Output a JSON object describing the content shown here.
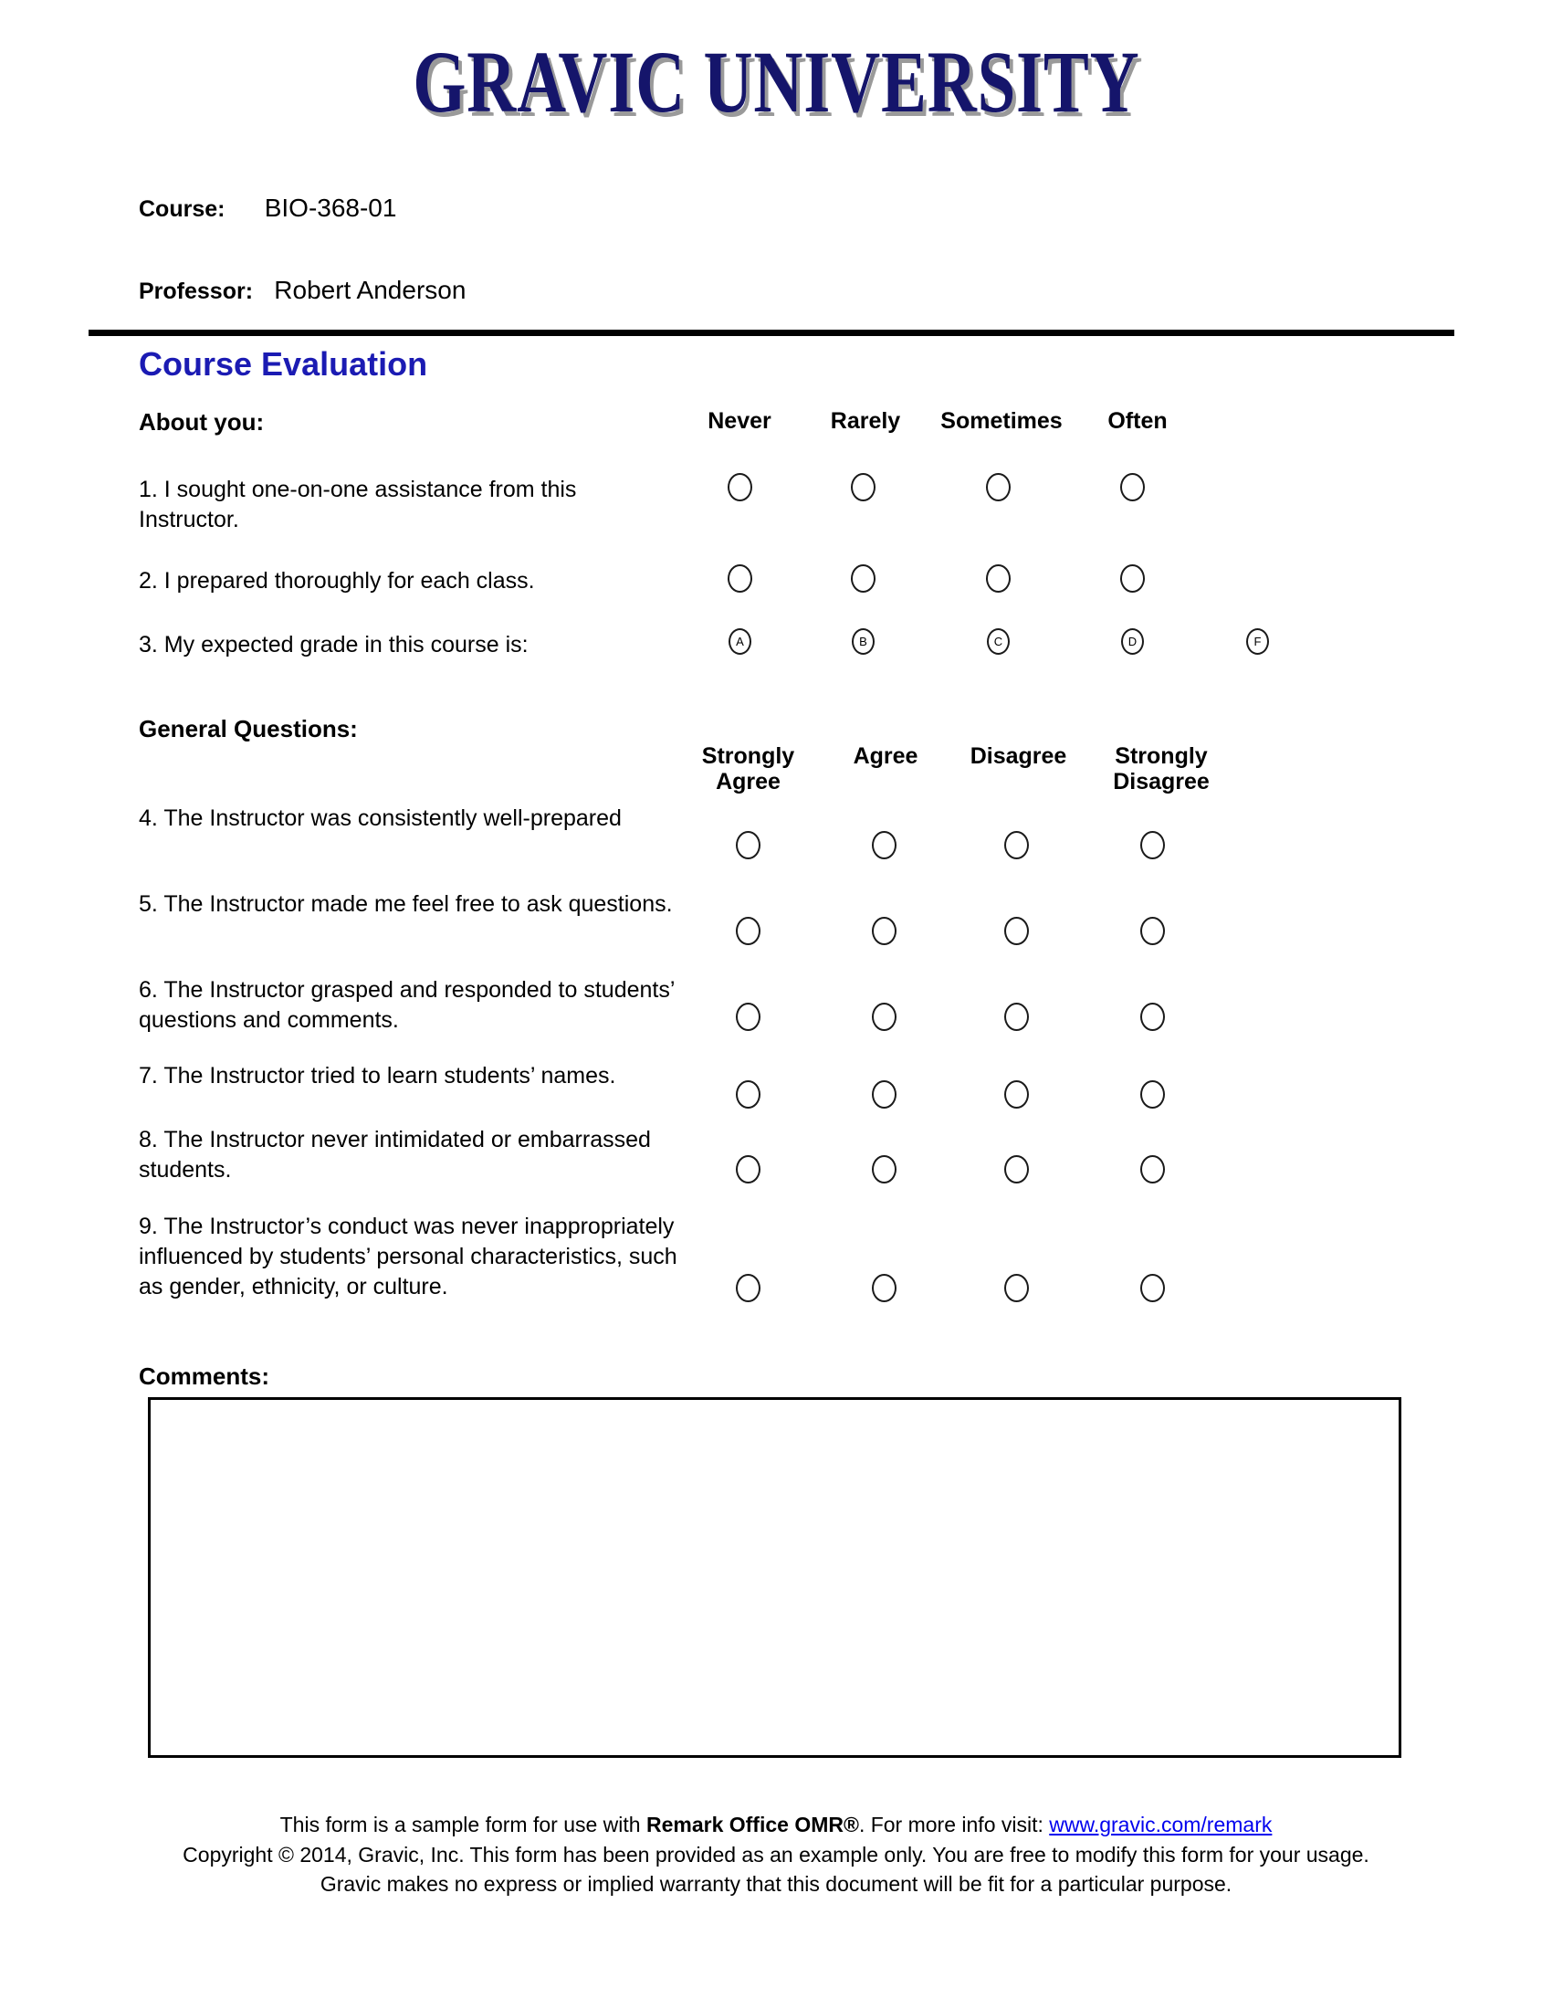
{
  "document": {
    "university_title": "GRAVIC UNIVERSITY",
    "title_color": "#15156b",
    "title_shadow_color": "#9a9a9a",
    "section_title": "Course Evaluation",
    "section_title_color": "#1b1bb3"
  },
  "header": {
    "course_label": "Course:",
    "course_value": "BIO-368-01",
    "professor_label": "Professor:",
    "professor_value": "Robert Anderson"
  },
  "about_you": {
    "label": "About you:",
    "scale": [
      "Never",
      "Rarely",
      "Sometimes",
      "Often"
    ],
    "grade_options": [
      "A",
      "B",
      "C",
      "D",
      "F"
    ],
    "questions": [
      {
        "number": "1.",
        "text": "1. I sought one-on-one assistance from this Instructor.",
        "type": "scale"
      },
      {
        "number": "2.",
        "text": "2. I prepared thoroughly for each class.",
        "type": "scale"
      },
      {
        "number": "3.",
        "text": "3. My expected grade in this course is:",
        "type": "grade"
      }
    ]
  },
  "general_questions": {
    "label": "General Questions:",
    "scale": [
      "Strongly Agree",
      "Agree",
      "Disagree",
      "Strongly Disagree"
    ],
    "scale_lines": [
      [
        "Strongly",
        "Agree"
      ],
      [
        "Agree"
      ],
      [
        "Disagree"
      ],
      [
        "Strongly",
        "Disagree"
      ]
    ],
    "questions": [
      {
        "number": "4.",
        "text": "4. The Instructor was consistently well-prepared"
      },
      {
        "number": "5.",
        "text": "5. The Instructor made me feel free to ask questions."
      },
      {
        "number": "6.",
        "text": "6. The Instructor grasped and responded to students’ questions and comments."
      },
      {
        "number": "7.",
        "text": "7. The Instructor tried to learn students’ names."
      },
      {
        "number": "8.",
        "text": "8. The Instructor never intimidated or embarrassed students."
      },
      {
        "number": "9.",
        "text": "9. The Instructor’s conduct was never inappropriately influenced by students’ personal characteristics, such as gender, ethnicity, or culture."
      }
    ]
  },
  "comments": {
    "label": "Comments:",
    "value": ""
  },
  "footer": {
    "line1_part1": "This form is a sample form for use with ",
    "line1_bold": "Remark Office OMR®",
    "line1_part2": ". For more info visit: ",
    "line1_link": "www.gravic.com/remark",
    "line2": "Copyright © 2014, Gravic, Inc. This form has been provided as an example only. You are free to modify this form for your usage.",
    "line3": "Gravic makes no express or implied warranty that this document will be fit for a particular purpose.",
    "link_color": "#0000ee"
  }
}
